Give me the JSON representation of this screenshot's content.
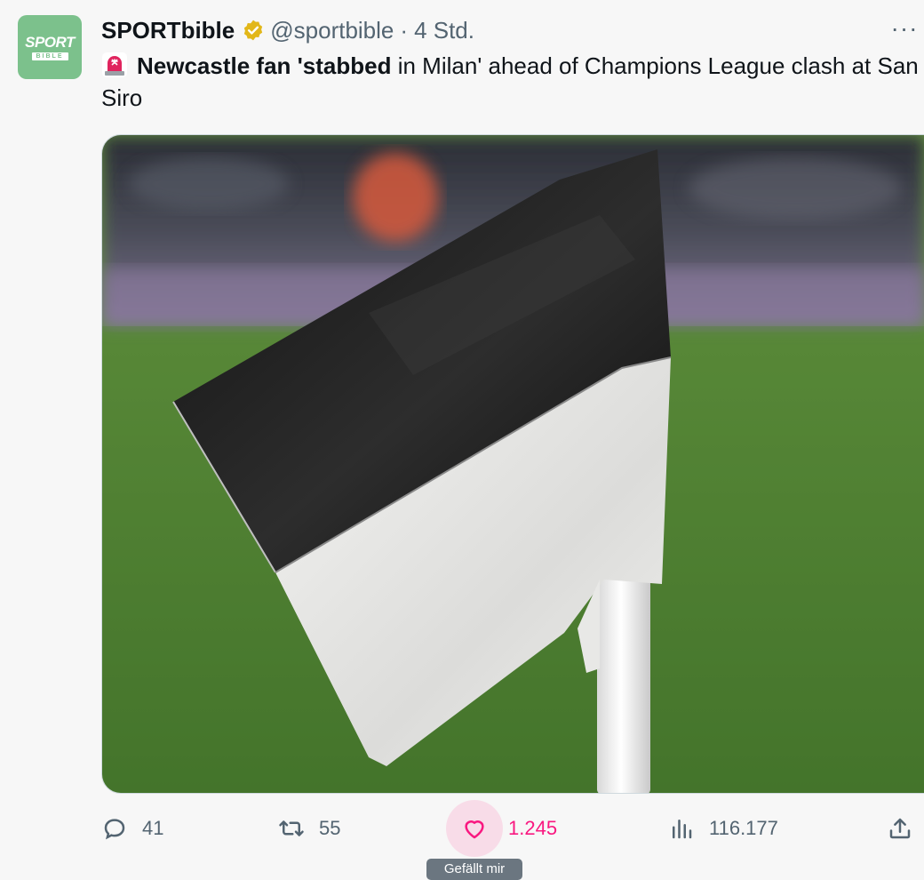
{
  "tweet": {
    "avatar": {
      "word": "SPORT",
      "sub": "BIBLE",
      "color": "#7cc18c"
    },
    "author_name": "SPORTbible",
    "verified_badge": "gold-check-badge-icon",
    "handle": "@sportbible",
    "separator": "·",
    "time": "4 Std.",
    "more_label": "···",
    "text": {
      "emoji": "rotating-light-icon",
      "bold": "Newcastle fan 'stabbed",
      "rest": " in Milan' ahead of Champions League clash at San Siro"
    },
    "media": {
      "description_icon": "corner-flag-photo",
      "colors": {
        "flag_black": "#1b1b1b",
        "flag_white": "#f2f2f0",
        "pitch": "#4d7d30"
      }
    },
    "actions": {
      "reply_count": "41",
      "retweet_count": "55",
      "like_count": "1.245",
      "views_count": "116.177"
    },
    "tooltip": "Gefällt mir",
    "accent": "#f91880"
  }
}
